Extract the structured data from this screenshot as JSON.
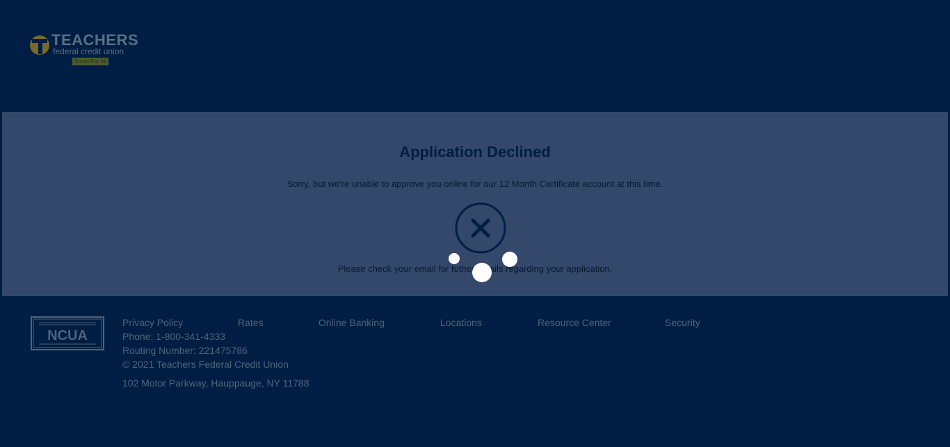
{
  "header": {
    "logo": {
      "name": "TEACHERS",
      "subtitle": "federal credit union",
      "tagline": "Smart For All"
    }
  },
  "main": {
    "title": "Application Declined",
    "message": "Sorry, but we're unable to approve you online for our 12 Month Certificate account at this time.",
    "secondary_message": "Please check your email for futher details regarding your application.",
    "status_icon": "declined-x-circle-icon"
  },
  "overlay": {
    "loading_icon": "loading-spinner-icon"
  },
  "footer": {
    "ncua_badge": {
      "label": "NCUA",
      "icon": "ncua-badge-icon"
    },
    "links": [
      {
        "label": "Privacy Policy"
      },
      {
        "label": "Rates"
      },
      {
        "label": "Online Banking"
      },
      {
        "label": "Locations"
      },
      {
        "label": "Resource Center"
      },
      {
        "label": "Security"
      }
    ],
    "phone": "Phone: 1-800-341-4333",
    "routing": "Routing Number: 221475786",
    "copyright": "© 2021 Teachers Federal Credit Union",
    "address": "102 Motor Parkway, Hauppauge, NY 11788"
  },
  "colors": {
    "background": "#001e43",
    "panel": "#33486a",
    "title": "#001e43",
    "footer_text": "#4f637c",
    "spinner": "#ffffff"
  }
}
